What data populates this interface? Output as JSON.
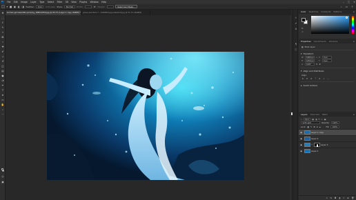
{
  "app": {
    "logo": "Ps"
  },
  "menu": [
    "File",
    "Edit",
    "Image",
    "Layer",
    "Type",
    "Select",
    "Filter",
    "3D",
    "View",
    "Plugins",
    "Window",
    "Help"
  ],
  "window_controls": [
    "–",
    "□",
    "✕"
  ],
  "options_bar": {
    "feather_label": "Feather:",
    "feather_value": "0 px",
    "antialias_label": "Anti-alias",
    "style_label": "Style:",
    "style_value": "Normal",
    "width_label": "Width:",
    "height_label": "Height:",
    "select_mask_label": "Select and Mask..."
  },
  "tabs": [
    {
      "label": "woman-girl-beautiful-jumping_1680x1050.jpg @ 45.1% (Layer 1 copy, RGB/8) *",
      "active": true
    },
    {
      "label": "group-wonders-7…7e6d8b0.jpg-snapshot.jpg @ 51.1% (RGB/8)",
      "active": false
    }
  ],
  "panels": {
    "color": {
      "tabs": [
        "Color",
        "Swatches",
        "Gradients",
        "Patterns"
      ],
      "active": 0
    },
    "properties": {
      "tabs": [
        "Properties",
        "Adjustments",
        "Libraries"
      ],
      "active": 0,
      "layer_type": "Pixel Layer",
      "transform_title": "Transform",
      "w_label": "W",
      "w_value": "1680 px",
      "h_label": "H",
      "h_value": "1050 px",
      "x_label": "X",
      "x_value": "0 px",
      "y_label": "Y",
      "y_value": "0 px",
      "angle_value": "0.00°",
      "align_title": "Align and Distribute",
      "align_sub": "Align:",
      "quick_actions_title": "Quick Actions"
    },
    "layers": {
      "tabs": [
        "Layers",
        "Channels",
        "Paths"
      ],
      "active": 0,
      "kind_label": "Kind",
      "blend_mode": "Soft Light",
      "opacity_label": "Opacity:",
      "opacity_value": "100%",
      "lock_label": "Lock:",
      "fill_label": "Fill:",
      "fill_value": "100%",
      "items": [
        {
          "name": "Layer 1 copy",
          "selected": true,
          "visible": true,
          "masked": false
        },
        {
          "name": "Layer 2",
          "selected": false,
          "visible": true,
          "masked": false
        },
        {
          "name": "Layer 3",
          "selected": false,
          "visible": true,
          "masked": true
        },
        {
          "name": "Layer 1",
          "selected": false,
          "visible": true,
          "masked": false
        }
      ]
    }
  },
  "colors": {
    "accent": "#31a8ff",
    "water_deep": "#061b33",
    "water_light": "#2bc6e6"
  }
}
